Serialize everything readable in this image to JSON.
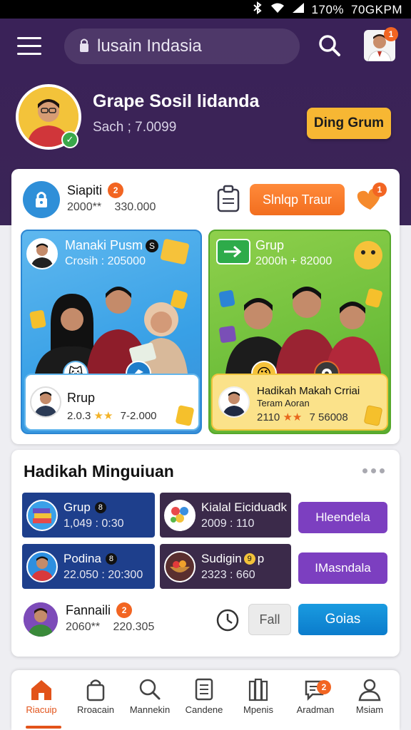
{
  "status_bar": {
    "battery": "170%",
    "time": "70GKPM"
  },
  "header": {
    "search_text": "lusain Indasia",
    "avatar_badge": "1"
  },
  "profile": {
    "name": "Grape Sosil lidanda",
    "subtitle": "Sach ; 7.0099",
    "action_label": "Ding Grum"
  },
  "summary_row": {
    "title": "Siapiti",
    "badge": "2",
    "stat_left": "2000**",
    "stat_right": "330.000",
    "button_label": "Slnlqp Traur",
    "heart_badge": "1"
  },
  "promo_cards": [
    {
      "title": "Manaki Pusm",
      "title_badge": "S",
      "stat": "Crosih : 205000",
      "footer_title": "Rrup",
      "footer_stat_left": "2.0.3",
      "footer_stat_right": "7-2.000"
    },
    {
      "title": "Grup",
      "stat": "2000h + 82000",
      "footer_title": "Hadikah Makah Crriai",
      "footer_sub": "Teram Aoran",
      "footer_stat_left": "2110",
      "footer_stat_right": "7 56008"
    }
  ],
  "section": {
    "title": "Hadikah Minguiuan",
    "tiles": [
      {
        "title": "Grup",
        "badge": "8",
        "stat": "1,049 : 0:30"
      },
      {
        "title": "Kialal Eiciduadk",
        "stat": "2009 : 110"
      },
      {
        "title": "Podina",
        "badge": "8",
        "stat": "22.050 : 20:300"
      },
      {
        "title": "Sudigin",
        "badge": "9",
        "title_suffix": "p",
        "stat": "2323 : 660"
      }
    ],
    "side_buttons": [
      "Hleendela",
      "IMasndala"
    ],
    "footer_row": {
      "title": "Fannaili",
      "badge": "2",
      "stat_left": "2060**",
      "stat_right": "220.305",
      "fall_label": "Fall",
      "go_label": "Goias"
    }
  },
  "bottom_nav": [
    {
      "label": "Riacuip",
      "icon": "home-icon",
      "active": true
    },
    {
      "label": "Rroacain",
      "icon": "bag-icon"
    },
    {
      "label": "Mannekin",
      "icon": "search-icon"
    },
    {
      "label": "Candene",
      "icon": "list-icon"
    },
    {
      "label": "Mpenis",
      "icon": "books-icon"
    },
    {
      "label": "Aradman",
      "icon": "chat-icon",
      "badge": "2"
    },
    {
      "label": "Msiam",
      "icon": "user-icon"
    }
  ],
  "colors": {
    "header_purple": "#3a2258",
    "accent_orange": "#f26e1f",
    "accent_yellow": "#f7b733",
    "promo_blue": "#38a0e6",
    "promo_green": "#6dbe3a",
    "tile_navy": "#1e3f8c",
    "tile_plum": "#3b2a4a",
    "button_purple": "#7c3fc0",
    "button_blue": "#0b7ccc"
  }
}
